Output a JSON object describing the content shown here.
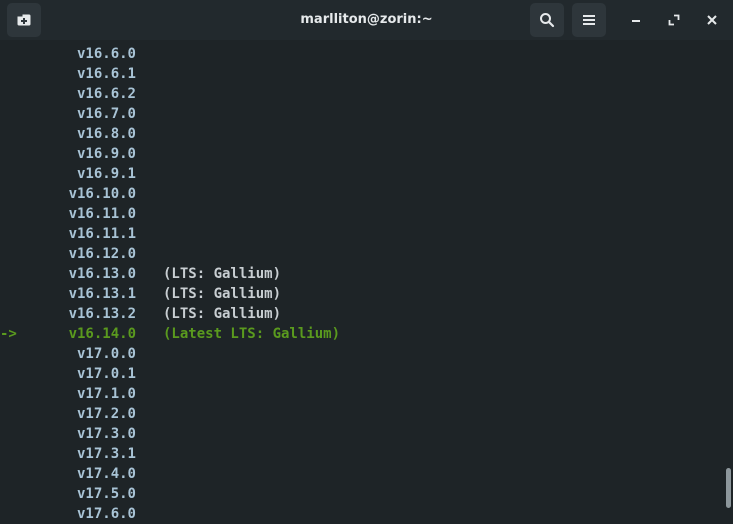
{
  "window": {
    "title": "marlliton@zorin:~"
  },
  "header": {
    "new_tab_icon": "new-tab-icon",
    "search_icon": "search-icon",
    "menu_icon": "hamburger-menu-icon",
    "minimize_icon": "minimize-icon",
    "maximize_icon": "maximize-icon",
    "close_icon": "close-icon"
  },
  "terminal": {
    "current_marker": "->",
    "lines": [
      {
        "version": "v16.6.0",
        "note": ""
      },
      {
        "version": "v16.6.1",
        "note": ""
      },
      {
        "version": "v16.6.2",
        "note": ""
      },
      {
        "version": "v16.7.0",
        "note": ""
      },
      {
        "version": "v16.8.0",
        "note": ""
      },
      {
        "version": "v16.9.0",
        "note": ""
      },
      {
        "version": "v16.9.1",
        "note": ""
      },
      {
        "version": "v16.10.0",
        "note": ""
      },
      {
        "version": "v16.11.0",
        "note": ""
      },
      {
        "version": "v16.11.1",
        "note": ""
      },
      {
        "version": "v16.12.0",
        "note": ""
      },
      {
        "version": "v16.13.0",
        "note": "(LTS: Gallium)"
      },
      {
        "version": "v16.13.1",
        "note": "(LTS: Gallium)"
      },
      {
        "version": "v16.13.2",
        "note": "(LTS: Gallium)"
      },
      {
        "version": "v16.14.0",
        "note": "(Latest LTS: Gallium)",
        "current": true
      },
      {
        "version": "v17.0.0",
        "note": ""
      },
      {
        "version": "v17.0.1",
        "note": ""
      },
      {
        "version": "v17.1.0",
        "note": ""
      },
      {
        "version": "v17.2.0",
        "note": ""
      },
      {
        "version": "v17.3.0",
        "note": ""
      },
      {
        "version": "v17.3.1",
        "note": ""
      },
      {
        "version": "v17.4.0",
        "note": ""
      },
      {
        "version": "v17.5.0",
        "note": ""
      },
      {
        "version": "v17.6.0",
        "note": ""
      }
    ]
  },
  "colors": {
    "background": "#1e2427",
    "header": "#22292d",
    "version_text": "#a9c4d6",
    "note_text": "#c8ced2",
    "current_green": "#5a9a1e"
  }
}
